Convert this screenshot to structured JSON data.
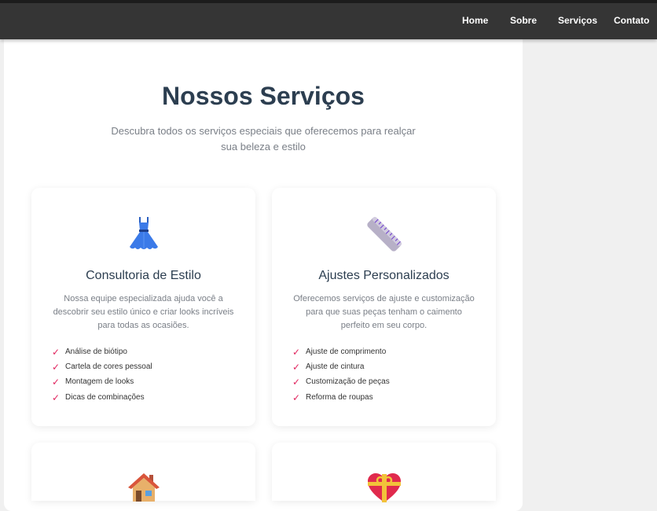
{
  "nav": {
    "items": [
      "Home",
      "Sobre",
      "Serviços",
      "Contato"
    ]
  },
  "header": {
    "title": "Nossos Serviços",
    "subtitle": "Descubra todos os serviços especiais que oferecemos para realçar sua beleza e estilo"
  },
  "cards": [
    {
      "icon": "dress-icon",
      "title": "Consultoria de Estilo",
      "description": "Nossa equipe especializada ajuda você a descobrir seu estilo único e criar looks incríveis para todas as ocasiões.",
      "items": [
        "Análise de biótipo",
        "Cartela de cores pessoal",
        "Montagem de looks",
        "Dicas de combinações"
      ]
    },
    {
      "icon": "ruler-icon",
      "title": "Ajustes Personalizados",
      "description": "Oferecemos serviços de ajuste e customização para que suas peças tenham o caimento perfeito em seu corpo.",
      "items": [
        "Ajuste de comprimento",
        "Ajuste de cintura",
        "Customização de peças",
        "Reforma de roupas"
      ]
    },
    {
      "icon": "house-icon"
    },
    {
      "icon": "heart-gift-icon"
    }
  ],
  "check_symbol": "✓",
  "colors": {
    "accent": "#e0245e",
    "heading": "#2c3e50",
    "nav_bg": "#353535"
  }
}
